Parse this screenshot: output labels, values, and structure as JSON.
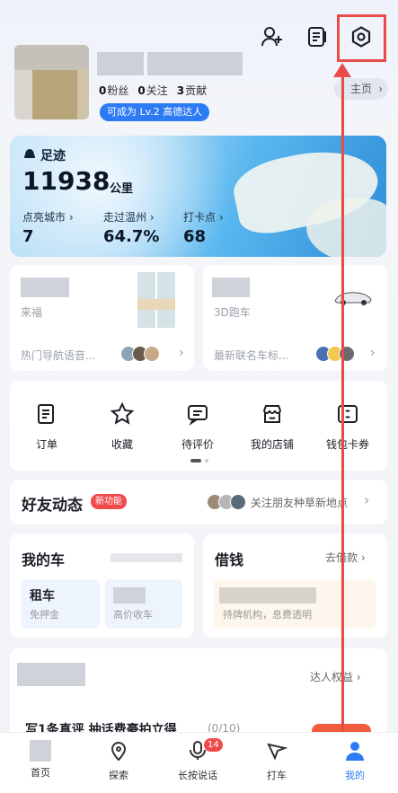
{
  "profile": {
    "fans_count": "0",
    "fans_label": "粉丝",
    "following_count": "0",
    "following_label": "关注",
    "contrib_count": "3",
    "contrib_label": "贡献",
    "level_badge": "可成为 Lv.2 高德达人",
    "home_label": "主页"
  },
  "footprint": {
    "title": "足迹",
    "distance": "11938",
    "unit": "公里",
    "stats": [
      {
        "label": "点亮城市",
        "value": "7"
      },
      {
        "label": "走过温州",
        "value": "64.7%"
      },
      {
        "label": "打卡点",
        "value": "68"
      }
    ]
  },
  "cards": {
    "left_sub": "来福",
    "left_footer": "热门导航语音...",
    "right_sub": "3D跑车",
    "right_footer": "最新联名车标..."
  },
  "quick": [
    {
      "label": "订单",
      "icon": "order-icon"
    },
    {
      "label": "收藏",
      "icon": "star-icon"
    },
    {
      "label": "待评价",
      "icon": "comment-icon"
    },
    {
      "label": "我的店铺",
      "icon": "shop-icon"
    },
    {
      "label": "钱包卡券",
      "icon": "wallet-icon"
    }
  ],
  "friends": {
    "title": "好友动态",
    "new_badge": "新功能",
    "cta": "关注朋友种草新地点"
  },
  "car": {
    "title": "我的车",
    "rent_title": "租车",
    "rent_sub": "免押金",
    "sell_sub": "高价收车"
  },
  "loan": {
    "title": "借钱",
    "action": "去借款",
    "sub": "持牌机构，息费透明"
  },
  "creator": {
    "link": "达人权益",
    "task": "写1条真评 抽话费豪拍立得",
    "progress": "(0/10)"
  },
  "nav": [
    {
      "label": "首页"
    },
    {
      "label": "探索"
    },
    {
      "label": "长按说话",
      "badge": "14"
    },
    {
      "label": "打车"
    },
    {
      "label": "我的"
    }
  ],
  "colors": {
    "accent": "#2d7af5",
    "highlight": "#e94a4a",
    "badge": "#ef4b4b"
  }
}
